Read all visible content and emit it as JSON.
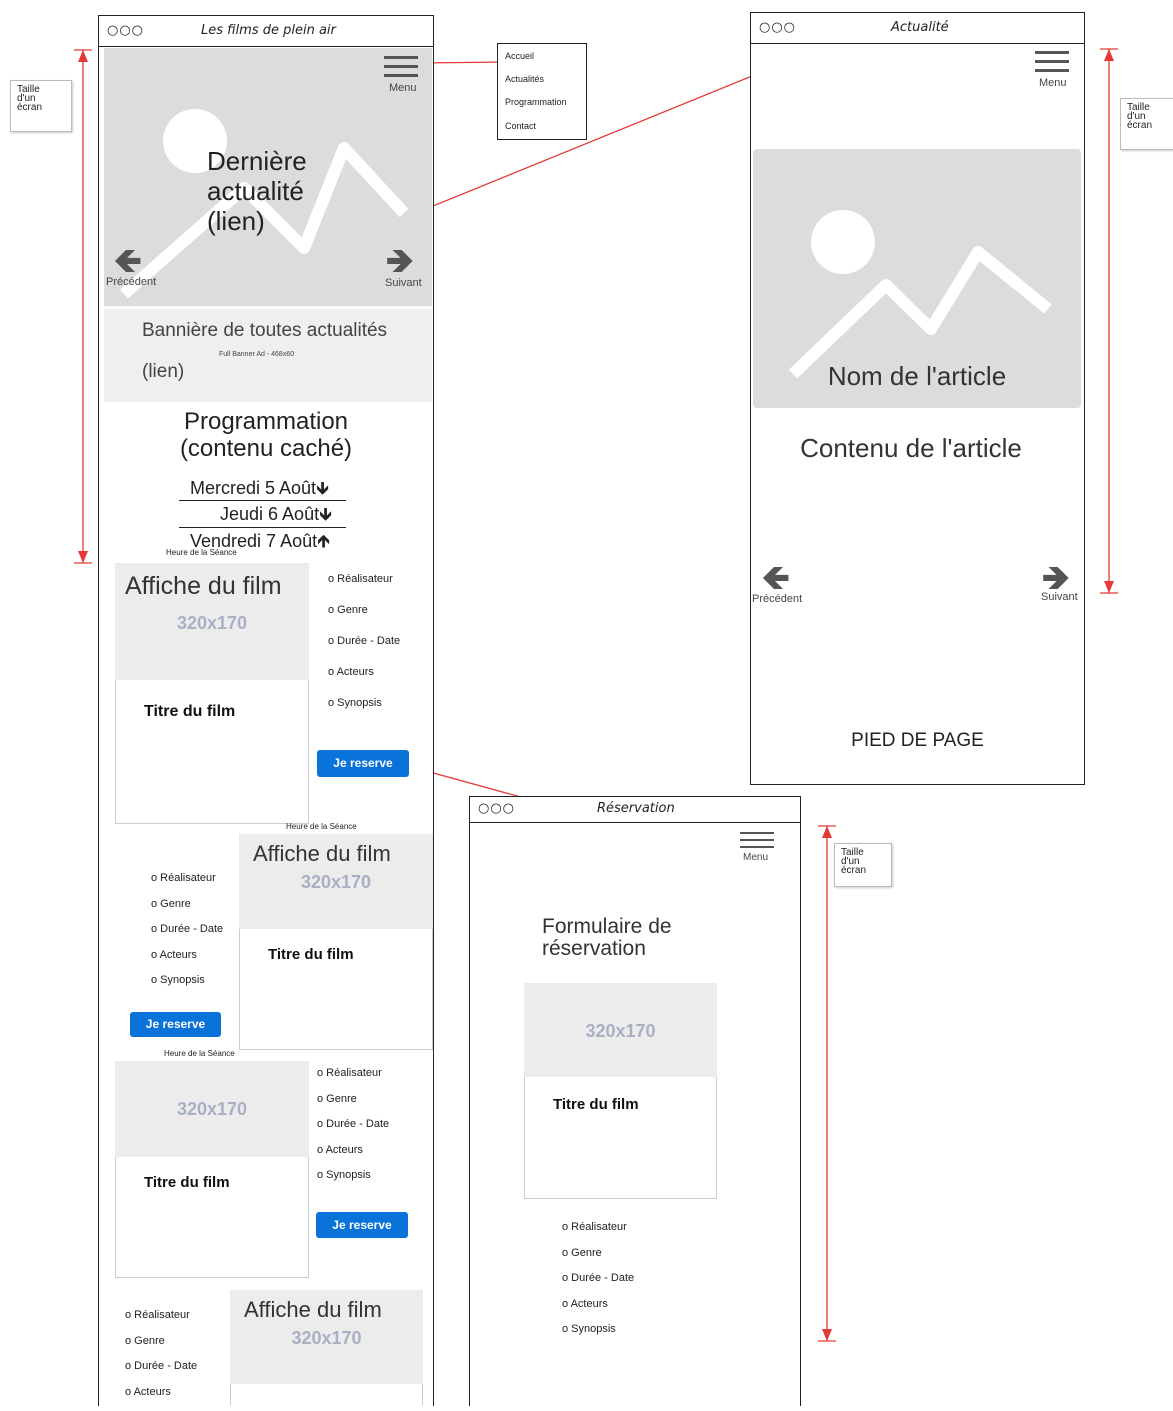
{
  "frames": {
    "home": {
      "title": "Les films de plein air"
    },
    "news": {
      "title": "Actualité"
    },
    "booking": {
      "title": "Réservation"
    }
  },
  "window_dots": "○○○",
  "menu_label": "Menu",
  "dropdown": [
    "Accueil",
    "Actualités",
    "Programmation",
    "Contact"
  ],
  "annotation": {
    "line1": "Taille",
    "line2": "d'un",
    "line3": "écran"
  },
  "hero": {
    "line1": "Dernière",
    "line2": "actualité",
    "line3": "(lien)",
    "prev": "Précédent",
    "next": "Suivant"
  },
  "banner": {
    "title": "Bannière de toutes actualités",
    "sub": "Full Banner Ad - 468x60",
    "link": "(lien)"
  },
  "programmation": {
    "line1": "Programmation",
    "line2": "(contenu caché)",
    "dates": [
      "Mercredi 5 Août",
      "Jeudi 6 Août",
      "Vendredi 7 Août"
    ]
  },
  "film": {
    "showtime": "Heure de la Séance",
    "poster": "Affiche du film",
    "size": "320x170",
    "title": "Titre du film",
    "button": "Je reserve",
    "info": [
      "o Réalisateur",
      "o Genre",
      "o Durée - Date",
      "o Acteurs",
      "o Synopsis"
    ]
  },
  "article": {
    "name": "Nom de l'article",
    "content": "Contenu de l'article",
    "prev": "Précédent",
    "next": "Suivant",
    "footer": "PIED DE PAGE"
  },
  "reservation": {
    "line1": "Formulaire de",
    "line2": "réservation"
  },
  "icons": {
    "down": "🡻",
    "up": "🡹",
    "left": "🡸",
    "right": "🡺"
  },
  "colors": {
    "accent": "#0a73d9",
    "arrow_line": "#e53935"
  }
}
